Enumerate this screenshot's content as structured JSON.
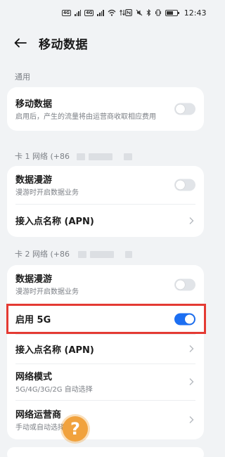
{
  "status_bar": {
    "sim1": "4G",
    "sim2": "4G",
    "time": "12:43"
  },
  "header": {
    "title": "移动数据"
  },
  "general": {
    "section_label": "通用",
    "mobile_data": {
      "title": "移动数据",
      "subtitle": "启用后，产生的流量将由运营商收取相应费用",
      "enabled": false
    }
  },
  "sim1": {
    "section_label": "卡 1 网络 (+86",
    "data_roaming": {
      "title": "数据漫游",
      "subtitle": "漫游时开启数据业务",
      "enabled": false
    },
    "apn": {
      "title": "接入点名称 (APN)"
    }
  },
  "sim2": {
    "section_label": "卡 2 网络 (+86",
    "data_roaming": {
      "title": "数据漫游",
      "subtitle": "漫游时开启数据业务",
      "enabled": false
    },
    "enable_5g": {
      "title": "启用 5G",
      "enabled": true
    },
    "apn": {
      "title": "接入点名称 (APN)"
    },
    "network_mode": {
      "title": "网络模式",
      "subtitle": "5G/4G/3G/2G 自动选择"
    },
    "carrier": {
      "title": "网络运营商",
      "subtitle": "手动或自动选择"
    }
  },
  "overlay": {
    "help_glyph": "?"
  },
  "colors": {
    "accent": "#1c6ff2",
    "highlight": "#e43a33",
    "help": "#f1a23d"
  }
}
